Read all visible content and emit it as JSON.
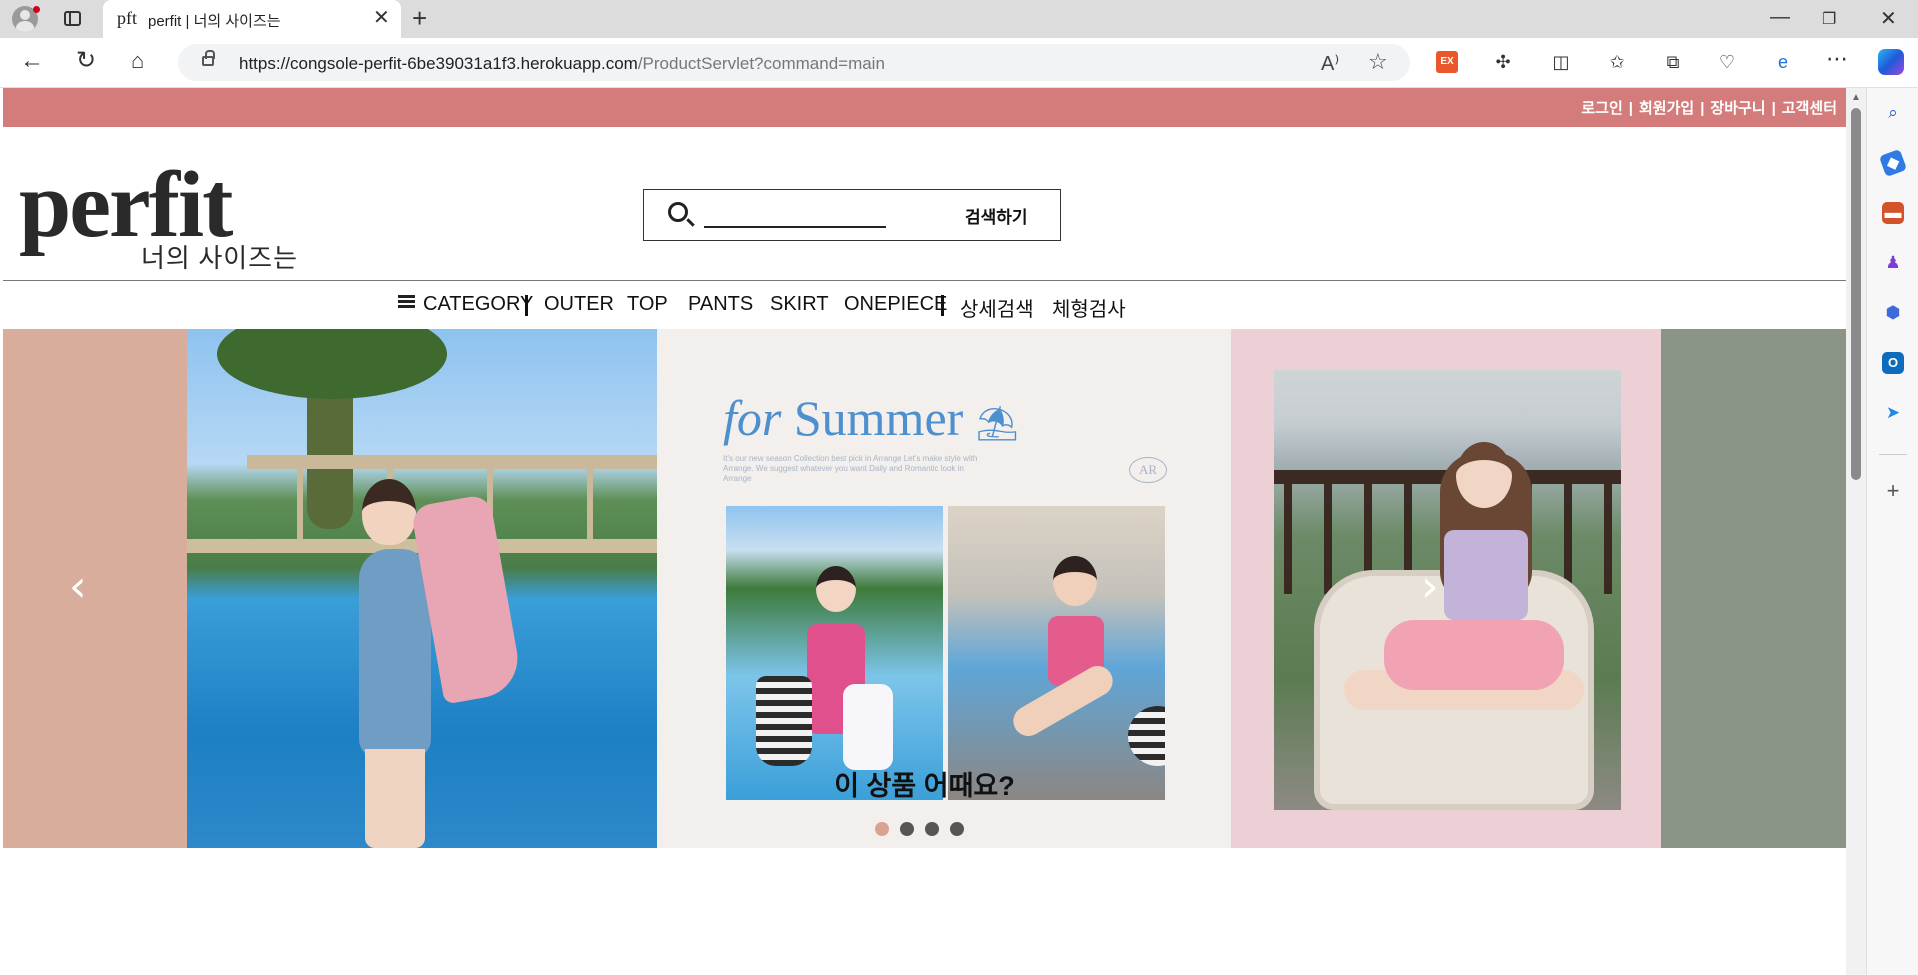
{
  "browser": {
    "tab_favicon": "pft",
    "tab_title": "perfit | 너의 사이즈는",
    "url_main": "https://congsole-perfit-6be39031a1f3.herokuapp.com",
    "url_path": "/ProductServlet?command=main",
    "ext_badge": "EX"
  },
  "header": {
    "top_links": [
      "로그인",
      "회원가입",
      "장바구니",
      "고객센터"
    ],
    "separator": "|"
  },
  "logo": {
    "word": "perfit",
    "subtitle": "너의 사이즈는"
  },
  "search": {
    "placeholder": "",
    "button_label": "검색하기"
  },
  "menu": {
    "category_label": "CATEGORY",
    "items": [
      "OUTER",
      "TOP",
      "PANTS",
      "SKIRT",
      "ONEPIECE"
    ],
    "extra": [
      "상세검색",
      "체형검사"
    ]
  },
  "carousel": {
    "prev_label": "‹",
    "next_label": "›",
    "banner_title_a": "for",
    "banner_title_b": "Summer",
    "banner_emoji": "⛱",
    "banner_fineprint": "It's our new season Collection best pick in Arrange Let's make style with Arrange. We suggest whatever you want Daily and Romantic look in Arrange",
    "banner_logo": "AR",
    "slide_count": 4,
    "active_slide": 0
  },
  "section": {
    "title": "이 상품 어때요?"
  },
  "colors": {
    "accent_strip": "#d47c7c",
    "active_dot": "#d9a391",
    "summer_blue": "#4d8fcf"
  }
}
